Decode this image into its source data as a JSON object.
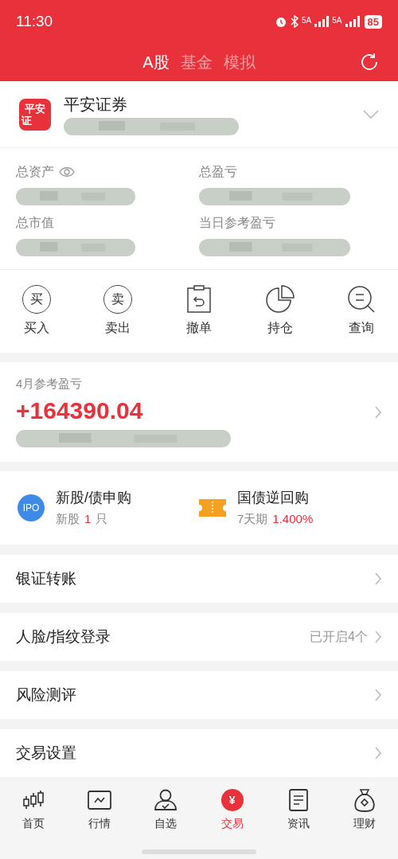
{
  "status_bar": {
    "time": "11:30",
    "sim1": "5A",
    "sim2": "5A",
    "battery": "85"
  },
  "tabs": [
    {
      "label": "A股",
      "selected": true
    },
    {
      "label": "基金",
      "selected": false
    },
    {
      "label": "模拟",
      "selected": false
    }
  ],
  "account": {
    "broker": "平安证券",
    "logo_top": "平安",
    "logo_bottom": "证"
  },
  "assets": [
    {
      "label": "总资产",
      "eye": true
    },
    {
      "label": "总盈亏"
    },
    {
      "label": "总市值"
    },
    {
      "label": "当日参考盈亏"
    }
  ],
  "actions": [
    {
      "label": "买入",
      "kind": "circle",
      "glyph": "买"
    },
    {
      "label": "卖出",
      "kind": "circle",
      "glyph": "卖"
    },
    {
      "label": "撤单",
      "kind": "clipboard"
    },
    {
      "label": "持仓",
      "kind": "pie"
    },
    {
      "label": "查询",
      "kind": "search"
    }
  ],
  "monthly": {
    "label": "4月参考盈亏",
    "value": "+164390.04"
  },
  "features": [
    {
      "kind": "ipo",
      "badge": "IPO",
      "title": "新股/债申购",
      "sub": "新股",
      "count": "1",
      "unit": "只"
    },
    {
      "kind": "ticket",
      "title": "国债逆回购",
      "sub": "7天期",
      "count": "1.400%"
    }
  ],
  "settings": [
    {
      "label": "银证转账"
    },
    {
      "label": "人脸/指纹登录",
      "value": "已开启4个"
    },
    {
      "label": "风险测评"
    },
    {
      "label": "交易设置"
    }
  ],
  "nav": [
    {
      "label": "首页",
      "kind": "candles",
      "selected": false
    },
    {
      "label": "行情",
      "kind": "chart",
      "selected": false
    },
    {
      "label": "自选",
      "kind": "person",
      "selected": false
    },
    {
      "label": "交易",
      "kind": "yuan",
      "selected": true,
      "glyph": "¥"
    },
    {
      "label": "资讯",
      "kind": "doc",
      "selected": false
    },
    {
      "label": "理财",
      "kind": "bag",
      "selected": false
    }
  ]
}
